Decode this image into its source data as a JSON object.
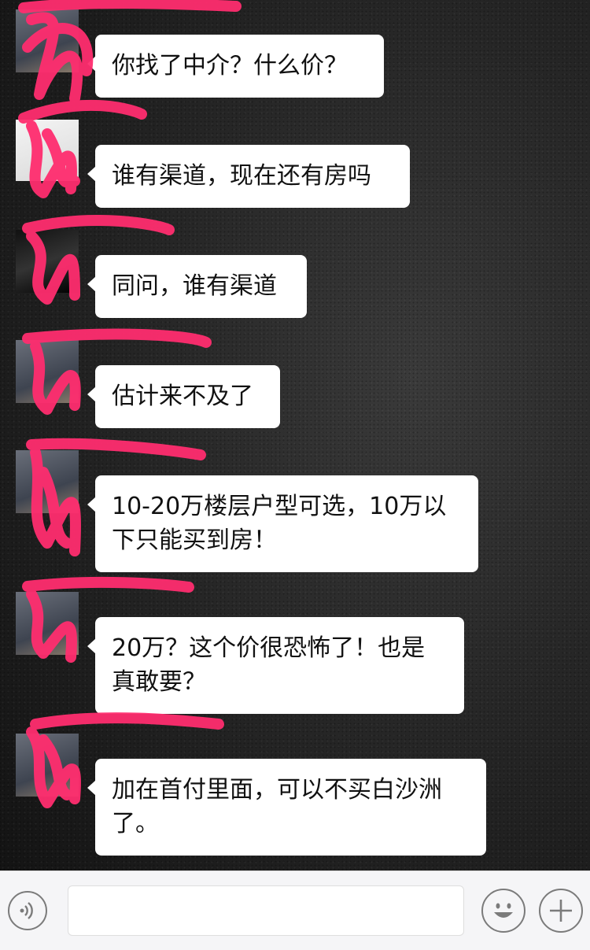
{
  "messages": [
    {
      "text": "你找了中介？什么价？"
    },
    {
      "text": "谁有渠道，现在还有房吗"
    },
    {
      "text": "同问，谁有渠道"
    },
    {
      "text": "估计来不及了"
    },
    {
      "text": "10-20万楼层户型可选，10万以下只能买到房！"
    },
    {
      "text": "20万？这个价很恐怖了！也是真敢要？"
    },
    {
      "text": "加在首付里面，可以不买白沙洲了。"
    }
  ],
  "input_bar": {
    "placeholder": "",
    "voice_icon": "voice-icon",
    "emoji_icon": "emoji-icon",
    "plus_icon": "plus-icon"
  },
  "colors": {
    "bubble": "#ffffff",
    "redaction": "#ff2d6f",
    "input_bar": "#f5f5f7"
  }
}
